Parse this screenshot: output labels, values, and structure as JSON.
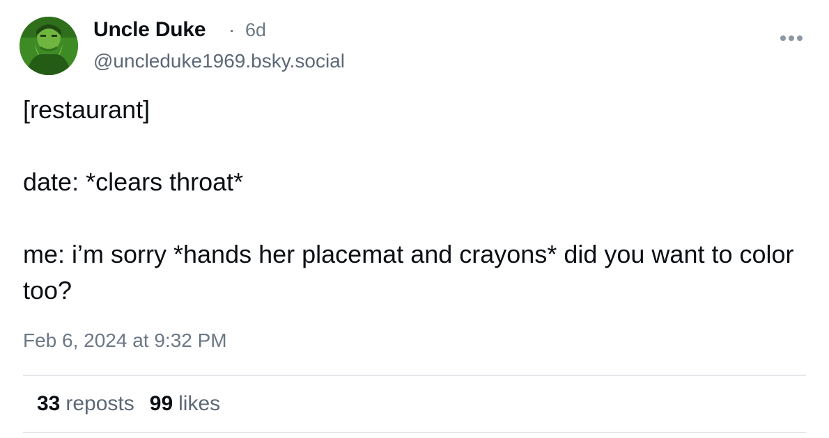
{
  "author": {
    "display_name": "Uncle Duke",
    "separator": "·",
    "age": "6d",
    "handle": "@uncleduke1969.bsky.social"
  },
  "post": {
    "lines": [
      "[restaurant]",
      "date: *clears throat*",
      "me: i’m sorry *hands her placemat and crayons* did you want to color too?"
    ],
    "timestamp": "Feb 6, 2024 at 9:32 PM"
  },
  "stats": {
    "reposts_count": "33",
    "reposts_label": "reposts",
    "likes_count": "99",
    "likes_label": "likes"
  },
  "icons": {
    "more": "more-horizontal-icon"
  },
  "colors": {
    "avatar_tint": "#3f8f26",
    "secondary_text": "#6b7785",
    "divider": "#e4e8ec"
  }
}
